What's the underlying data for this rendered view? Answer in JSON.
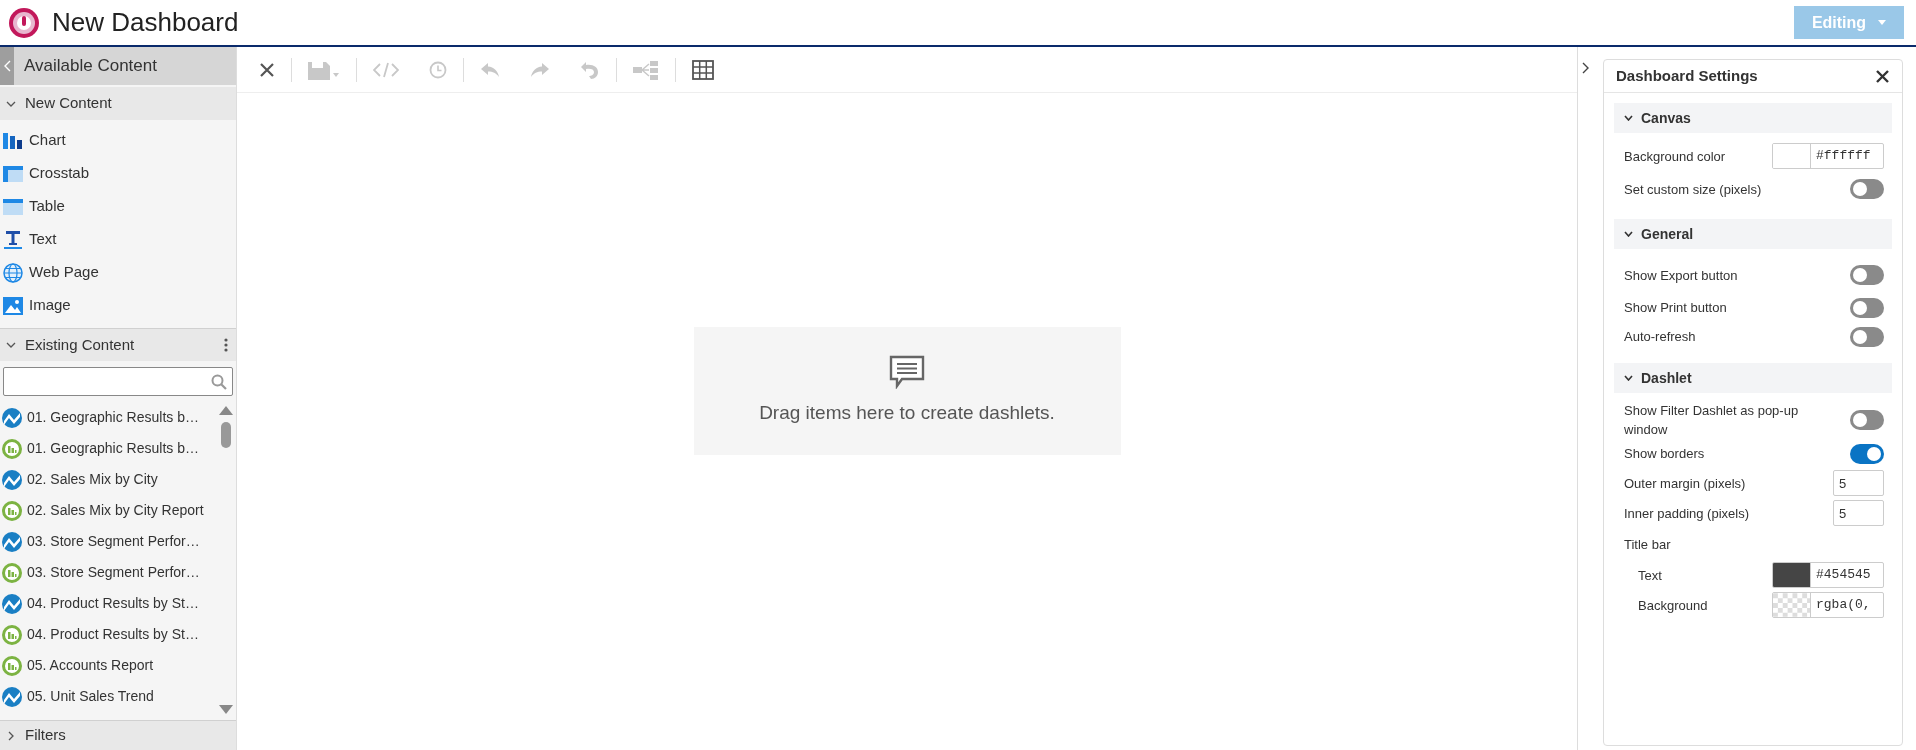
{
  "header": {
    "title": "New Dashboard",
    "mode_button": "Editing"
  },
  "left_panel": {
    "title": "Available Content",
    "new_content": {
      "title": "New Content",
      "expanded": true,
      "items": [
        {
          "kind": "chart",
          "label": "Chart"
        },
        {
          "kind": "crosstab",
          "label": "Crosstab"
        },
        {
          "kind": "table",
          "label": "Table"
        },
        {
          "kind": "text",
          "label": "Text"
        },
        {
          "kind": "webpage",
          "label": "Web Page"
        },
        {
          "kind": "image",
          "label": "Image"
        }
      ]
    },
    "existing_content": {
      "title": "Existing Content",
      "expanded": true,
      "items": [
        {
          "kind": "adhoc",
          "label": "01. Geographic Results b…"
        },
        {
          "kind": "report",
          "label": "01. Geographic Results b…"
        },
        {
          "kind": "adhoc",
          "label": "02. Sales Mix by City"
        },
        {
          "kind": "report",
          "label": "02. Sales Mix by City Report"
        },
        {
          "kind": "adhoc",
          "label": "03. Store Segment Perfor…"
        },
        {
          "kind": "report",
          "label": "03. Store Segment Perfor…"
        },
        {
          "kind": "adhoc",
          "label": "04. Product Results by St…"
        },
        {
          "kind": "report",
          "label": "04. Product Results by St…"
        },
        {
          "kind": "report",
          "label": "05. Accounts Report"
        },
        {
          "kind": "adhoc",
          "label": "05. Unit Sales Trend"
        }
      ]
    },
    "filters": {
      "title": "Filters",
      "expanded": false
    }
  },
  "toolbar": {
    "groups": [
      {
        "tools": [
          {
            "kind": "close",
            "disabled": false
          }
        ]
      },
      {
        "tools": [
          {
            "kind": "save",
            "disabled": true
          }
        ]
      },
      {
        "tools": [
          {
            "kind": "code",
            "disabled": true
          },
          {
            "kind": "history",
            "disabled": true
          }
        ]
      },
      {
        "tools": [
          {
            "kind": "undo",
            "disabled": true
          },
          {
            "kind": "redo",
            "disabled": true
          },
          {
            "kind": "undo-all",
            "disabled": true
          }
        ]
      },
      {
        "tools": [
          {
            "kind": "tree",
            "disabled": true
          }
        ]
      },
      {
        "tools": [
          {
            "kind": "grid",
            "disabled": false
          }
        ]
      }
    ]
  },
  "canvas": {
    "hint": "Drag items here to create dashlets."
  },
  "settings": {
    "title": "Dashboard Settings",
    "sections": [
      {
        "title": "Canvas",
        "expanded": true,
        "rows": [
          {
            "kind": "color",
            "label": "Background color",
            "color": "#ffffff",
            "value": "#ffffff"
          },
          {
            "kind": "toggle",
            "label": "Set custom size (pixels)",
            "on": false
          }
        ]
      },
      {
        "title": "General",
        "expanded": true,
        "rows": [
          {
            "kind": "toggle",
            "label": "Show Export button",
            "on": false
          },
          {
            "kind": "toggle",
            "label": "Show Print button",
            "on": false
          },
          {
            "kind": "toggle",
            "label": "Auto-refresh",
            "on": false
          }
        ]
      },
      {
        "title": "Dashlet",
        "expanded": true,
        "rows": [
          {
            "kind": "toggle",
            "label": "Show Filter Dashlet as pop-up window",
            "on": false
          },
          {
            "kind": "toggle",
            "label": "Show borders",
            "on": true
          },
          {
            "kind": "number",
            "label": "Outer margin (pixels)",
            "value": "5"
          },
          {
            "kind": "number",
            "label": "Inner padding (pixels)",
            "value": "5"
          },
          {
            "kind": "heading",
            "label": "Title bar"
          },
          {
            "kind": "sub-color",
            "label": "Text",
            "color": "#454545",
            "value": "#454545"
          },
          {
            "kind": "sub-color",
            "label": "Background",
            "transparent": true,
            "value": "rgba(0,"
          }
        ]
      }
    ]
  }
}
